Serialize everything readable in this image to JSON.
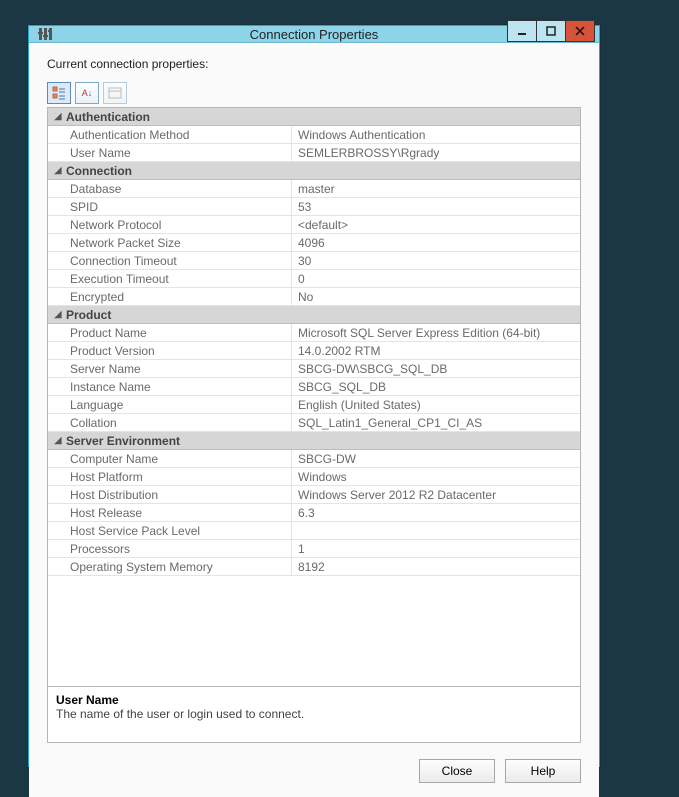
{
  "window": {
    "title": "Connection Properties",
    "icon": "properties-icon"
  },
  "header_label": "Current connection properties:",
  "toolbar": {
    "categorized_tip": "Categorized",
    "alphabetical_tip": "Alphabetical",
    "propertypages_tip": "Property Pages"
  },
  "categories": [
    {
      "name": "Authentication",
      "props": [
        {
          "name": "Authentication Method",
          "value": "Windows Authentication"
        },
        {
          "name": "User Name",
          "value": "SEMLERBROSSY\\Rgrady"
        }
      ]
    },
    {
      "name": "Connection",
      "props": [
        {
          "name": "Database",
          "value": "master"
        },
        {
          "name": "SPID",
          "value": "53"
        },
        {
          "name": "Network Protocol",
          "value": "<default>"
        },
        {
          "name": "Network Packet Size",
          "value": "4096"
        },
        {
          "name": "Connection Timeout",
          "value": "30"
        },
        {
          "name": "Execution Timeout",
          "value": "0"
        },
        {
          "name": "Encrypted",
          "value": "No"
        }
      ]
    },
    {
      "name": "Product",
      "props": [
        {
          "name": "Product Name",
          "value": "Microsoft SQL Server Express Edition (64-bit)"
        },
        {
          "name": "Product Version",
          "value": "14.0.2002 RTM"
        },
        {
          "name": "Server Name",
          "value": "SBCG-DW\\SBCG_SQL_DB"
        },
        {
          "name": "Instance Name",
          "value": "SBCG_SQL_DB"
        },
        {
          "name": "Language",
          "value": "English (United States)"
        },
        {
          "name": "Collation",
          "value": "SQL_Latin1_General_CP1_CI_AS"
        }
      ]
    },
    {
      "name": "Server Environment",
      "props": [
        {
          "name": "Computer Name",
          "value": "SBCG-DW"
        },
        {
          "name": "Host Platform",
          "value": "Windows"
        },
        {
          "name": "Host Distribution",
          "value": "Windows Server 2012 R2 Datacenter"
        },
        {
          "name": "Host Release",
          "value": "6.3"
        },
        {
          "name": "Host Service Pack Level",
          "value": ""
        },
        {
          "name": "Processors",
          "value": "1"
        },
        {
          "name": "Operating System Memory",
          "value": "8192"
        }
      ]
    }
  ],
  "description": {
    "title": "User Name",
    "text": "The name of the user or login used to connect."
  },
  "buttons": {
    "close": "Close",
    "help": "Help"
  }
}
